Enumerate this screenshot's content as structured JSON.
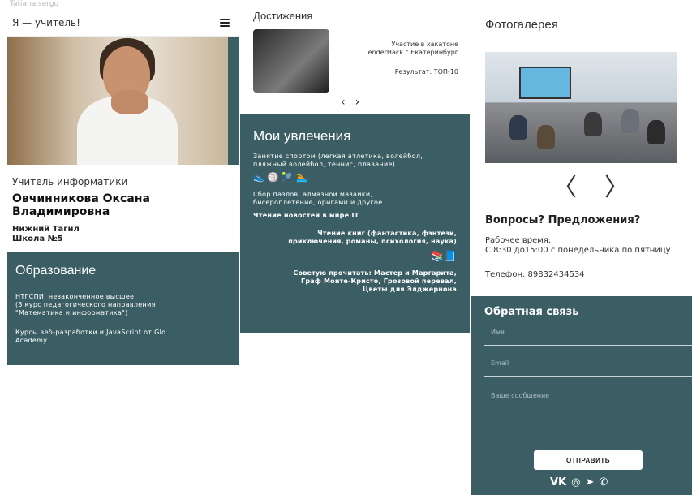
{
  "panel1": {
    "top_hint": "Tatiana sergo",
    "brand": "Я — учитель!",
    "role": "Учитель информатики",
    "name": "Овчинникова Оксана Владимировна",
    "city": "Нижний Тагил",
    "school": "Школа №5",
    "education": {
      "title": "Образование",
      "line1": "НТГСПИ, незаконченное высшее",
      "line2": "(3 курс педагогического направления",
      "line3": "\"Математика и информатика\")",
      "course1": "Курсы веб-разработки и JavaScript от Glo",
      "course2": "Academy"
    }
  },
  "panel2": {
    "achievements": {
      "title": "Достижения",
      "desc1": "Участие в хакатоне",
      "desc2": "TenderHack г.Екатеринбург",
      "result": "Результат: ТОП-10",
      "prev": "‹",
      "next": "›"
    },
    "hobbies": {
      "title": "Мои увлечения",
      "sport1": "Занятие спортом (легкая атлетика, волейбол,",
      "sport2": "пляжный волейбол, теннис, плавание)",
      "sport_icons": "👟🏐🎾🏊",
      "crafts1": "Сбор пазлов, алмазной мазаики,",
      "crafts2": "бисероплетение, оригами и другое",
      "news": "Чтение новостей в мире IT",
      "books1": "Чтение книг (фантастика, фэнтези,",
      "books2": "приключения, романы, психология, наука)",
      "book_icons": "📚📘",
      "advice1": "Советую прочитать: Мастер и Маргарита,",
      "advice2": "Граф Монте-Кристо, Грозовой перевал,",
      "advice3": "Цветы для Элджернона"
    }
  },
  "panel3": {
    "gallery": {
      "title": "Фотогалерея",
      "prev": "〈",
      "next": "〉"
    },
    "questions": "Вопросы? Предложения?",
    "work_label": "Рабочее время:",
    "work_time": "С 8:30 до15:00 с понедельника по пятницу",
    "phone": "Телефон: 89832434534",
    "feedback": {
      "title": "Обратная связь",
      "name_placeholder": "Имя",
      "email_placeholder": "Email",
      "message_placeholder": "Ваше сообщение",
      "send": "ОТПРАВИТЬ",
      "socials": [
        "VK",
        "◎",
        "➤",
        "✆"
      ]
    }
  },
  "colors": {
    "teal": "#3b5e64",
    "white": "#ffffff"
  }
}
